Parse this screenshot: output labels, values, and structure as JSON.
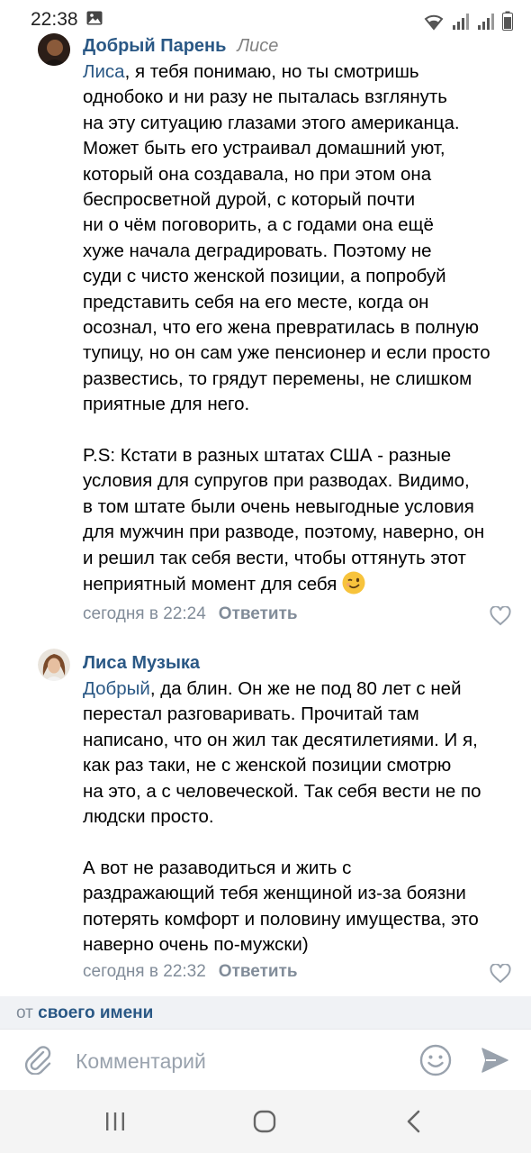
{
  "status_bar": {
    "time": "22:38"
  },
  "comments": [
    {
      "author": "Добрый Парень",
      "reply_to": "Лисе",
      "paragraphs": [
        [
          {
            "mention": "Лиса",
            "rest": ", я тебя понимаю, но ты смотришь"
          },
          "однобоко и ни разу не пыталась взглянуть",
          "на эту ситуацию глазами этого американца.",
          "Может быть его устраивал домашний уют,",
          "который она создавала, но при этом она",
          "беспросветной дурой, с который почти",
          "ни о чём поговорить, а с годами она ещё",
          "хуже начала деградировать. Поэтому не",
          "суди с чисто женской позиции, а попробуй",
          "представить себя на его месте, когда он",
          "осознал, что его жена превратилась в полную",
          "тупицу, но он сам уже пенсионер и если просто",
          "развестись, то грядут перемены, не слишком",
          "приятные для него."
        ],
        [
          "P.S: Кстати в разных штатах США - разные",
          "условия для супругов при разводах. Видимо,",
          "в том штате были очень невыгодные условия",
          "для мужчин при разводе, поэтому, наверно, он",
          "и решил так себя вести, чтобы оттянуть этот",
          "неприятный момент для себя"
        ]
      ],
      "emoji": "wink-emoji",
      "time": "сегодня в 22:24",
      "reply_label": "Ответить"
    },
    {
      "author": "Лиса Музыка",
      "paragraphs": [
        [
          {
            "mention": "Добрый",
            "rest": ", да блин. Он же не под 80 лет с ней"
          },
          "перестал разговаривать. Прочитай там",
          "написано, что он жил так десятилетиями. И я,",
          "как раз таки, не с женской позиции смотрю",
          "на это, а с человеческой. Так себя вести не по",
          "людски просто."
        ],
        [
          "А вот не разаводиться и жить с",
          "раздражающий тебя женщиной из-за боязни",
          "потерять комфорт и половину  имущества, это",
          "наверно очень по-мужски)"
        ]
      ],
      "time": "сегодня в 22:32",
      "reply_label": "Ответить"
    }
  ],
  "from_bar": {
    "prefix": "от",
    "name": "своего имени"
  },
  "composer": {
    "placeholder": "Комментарий",
    "value": ""
  },
  "icons": {
    "attach": "paperclip-icon",
    "emoji": "smile-icon",
    "send": "send-icon",
    "like": "heart-icon",
    "nav": [
      "recent-apps-icon",
      "home-icon",
      "back-icon"
    ]
  },
  "colors": {
    "accent": "#2a5885",
    "meta": "#818c99",
    "emoji": "#f7c33c"
  }
}
